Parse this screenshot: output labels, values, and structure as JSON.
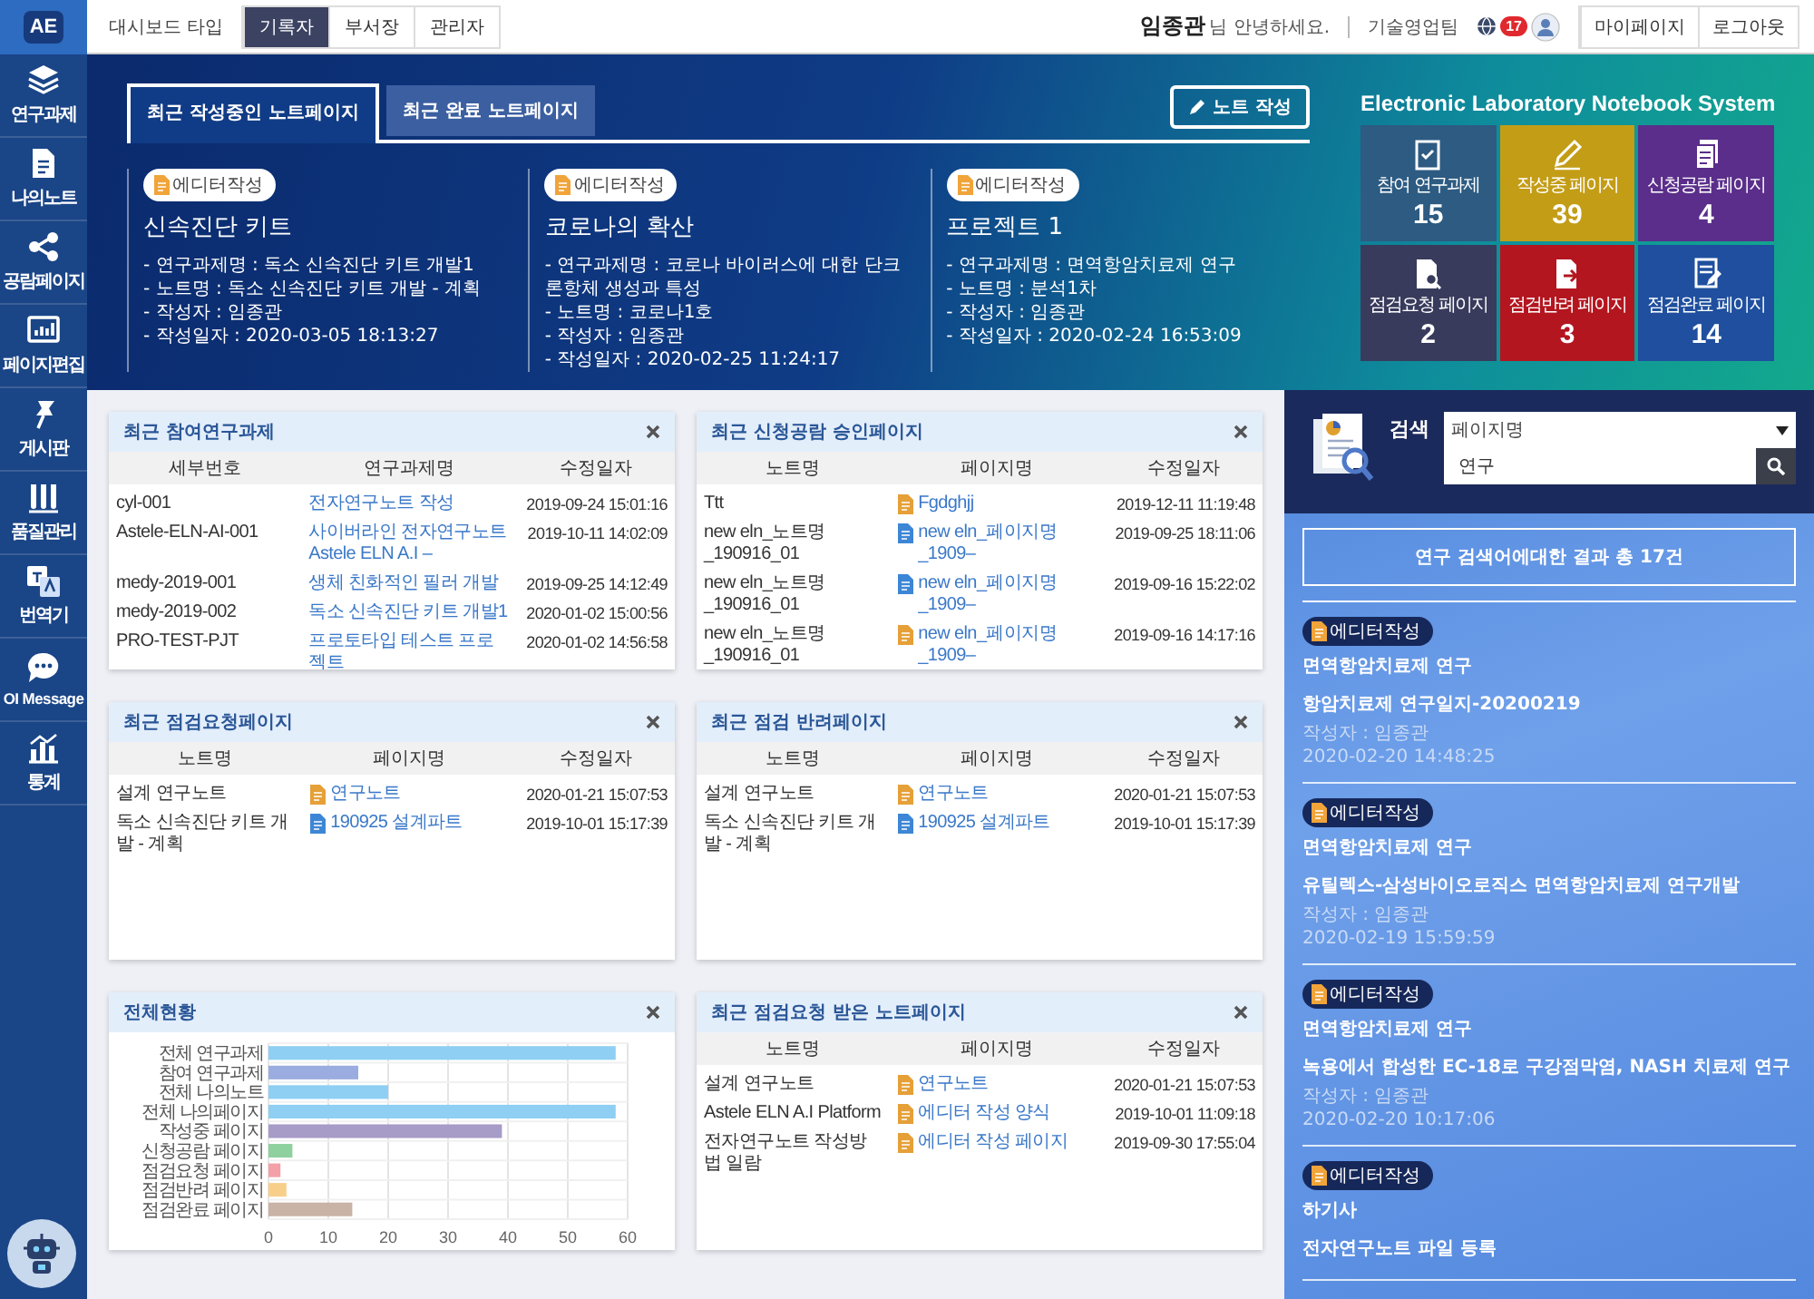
{
  "topbar": {
    "logo": "AE",
    "dashboard_label": "대시보드 타입",
    "dashboard_types": [
      {
        "label": "기록자",
        "selected": true
      },
      {
        "label": "부서장",
        "selected": false
      },
      {
        "label": "관리자",
        "selected": false
      }
    ],
    "user_name": "임종관",
    "greeting": "님 안녕하세요.",
    "team": "기술영업팀",
    "notification_count": "17",
    "buttons": [
      "마이페이지",
      "로그아웃"
    ]
  },
  "nav": [
    {
      "label": "연구과제"
    },
    {
      "label": "나의노트"
    },
    {
      "label": "공람페이지"
    },
    {
      "label": "페이지편집"
    },
    {
      "label": "게시판"
    },
    {
      "label": "품질관리"
    },
    {
      "label": "번역기"
    },
    {
      "label": "OI Message"
    },
    {
      "label": "통계"
    }
  ],
  "hero": {
    "tabs": [
      {
        "label": "최근 작성중인 노트페이지",
        "selected": true
      },
      {
        "label": "최근 완료 노트페이지",
        "selected": false
      }
    ],
    "write_button": "노트 작성",
    "cards": [
      {
        "badge": "에디터작성",
        "title": "신속진단 키트",
        "lines": [
          "- 연구과제명 : 독소 신속진단 키트 개발1",
          "- 노트명 : 독소 신속진단 키트 개발 - 계획",
          "- 작성자 : 임종관",
          "- 작성일자 : 2020-03-05 18:13:27"
        ]
      },
      {
        "badge": "에디터작성",
        "title": "코로나의 확산",
        "lines": [
          "- 연구과제명 : 코로나 바이러스에 대한 단크론항체 생성과 특성",
          "- 노트명 : 코로나1호",
          "- 작성자 : 임종관",
          "- 작성일자 : 2020-02-25 11:24:17"
        ]
      },
      {
        "badge": "에디터작성",
        "title": "프로젝트 1",
        "lines": [
          "- 연구과제명 : 면역항암치료제 연구",
          "- 노트명 : 분석1차",
          "- 작성자 : 임종관",
          "- 작성일자 : 2020-02-24 16:53:09"
        ]
      }
    ],
    "system_title": "Electronic Laboratory Notebook System",
    "tiles": [
      {
        "label": "참여 연구과제",
        "value": "15",
        "color": "#2d5b82"
      },
      {
        "label": "작성중 페이지",
        "value": "39",
        "color": "#c49d17"
      },
      {
        "label": "신청공람 페이지",
        "value": "4",
        "color": "#5a2e8a"
      },
      {
        "label": "점검요청 페이지",
        "value": "2",
        "color": "#383b5c"
      },
      {
        "label": "점검반려 페이지",
        "value": "3",
        "color": "#b3161f"
      },
      {
        "label": "점검완료 페이지",
        "value": "14",
        "color": "#1f4f9e"
      }
    ]
  },
  "panels": [
    {
      "kind": "table",
      "title": "최근 참여연구과제",
      "columns": [
        "세부번호",
        "연구과제명",
        "수정일자"
      ],
      "rows": [
        {
          "cells": [
            "cyl-001",
            {
              "text": "전자연구노트 작성"
            },
            "2019-09-24 15:01:16"
          ]
        },
        {
          "cells": [
            "Astele-ELN-AI-001",
            {
              "text": "사이버라인 전자연구노트 Astele ELN A.I –"
            },
            "2019-10-11 14:02:09"
          ]
        },
        {
          "cells": [
            "medy-2019-001",
            {
              "text": "생체 친화적인 필러 개발"
            },
            "2019-09-25 14:12:49"
          ]
        },
        {
          "cells": [
            "medy-2019-002",
            {
              "text": "독소 신속진단 키트 개발1"
            },
            "2020-01-02 15:00:56"
          ]
        },
        {
          "cells": [
            "PRO-TEST-PJT",
            {
              "text": "프로토타입 테스트 프로젝트"
            },
            "2020-01-02 14:56:58"
          ]
        }
      ]
    },
    {
      "kind": "table",
      "title": "최근 신청공람 승인페이지",
      "columns": [
        "노트명",
        "페이지명",
        "수정일자"
      ],
      "rows": [
        {
          "cells": [
            "Ttt",
            {
              "text": "Fgdghjj",
              "color": "#e5a038"
            },
            "2019-12-11 11:19:48"
          ]
        },
        {
          "cells": [
            "new eln_노트명_190916_01",
            {
              "text": "new eln_페이지명_1909–",
              "color": "#3d86d6"
            },
            "2019-09-25 18:11:06"
          ]
        },
        {
          "cells": [
            "new eln_노트명_190916_01",
            {
              "text": "new eln_페이지명_1909–",
              "color": "#3d86d6"
            },
            "2019-09-16 15:22:02"
          ]
        },
        {
          "cells": [
            "new eln_노트명_190916_01",
            {
              "text": "new eln_페이지명_1909–",
              "color": "#e5a038"
            },
            "2019-09-16 14:17:16"
          ]
        }
      ]
    },
    {
      "kind": "table",
      "title": "최근 점검요청페이지",
      "columns": [
        "노트명",
        "페이지명",
        "수정일자"
      ],
      "rows": [
        {
          "cells": [
            "설계 연구노트",
            {
              "text": "연구노트",
              "color": "#e5a038"
            },
            "2020-01-21 15:07:53"
          ]
        },
        {
          "cells": [
            "독소 신속진단 키트 개발 - 계획",
            {
              "text": "190925 설계파트",
              "color": "#3d86d6"
            },
            "2019-10-01 15:17:39"
          ]
        }
      ]
    },
    {
      "kind": "table",
      "title": "최근 점검 반려페이지",
      "columns": [
        "노트명",
        "페이지명",
        "수정일자"
      ],
      "rows": [
        {
          "cells": [
            "설계 연구노트",
            {
              "text": "연구노트",
              "color": "#e5a038"
            },
            "2020-01-21 15:07:53"
          ]
        },
        {
          "cells": [
            "독소 신속진단 키트 개발 - 계획",
            {
              "text": "190925 설계파트",
              "color": "#3d86d6"
            },
            "2019-10-01 15:17:39"
          ]
        }
      ]
    },
    {
      "kind": "chart",
      "title": "전체현황",
      "chart_data": {
        "type": "bar",
        "orientation": "horizontal",
        "categories": [
          "전체 연구과제",
          "참여 연구과제",
          "전체 나의노트",
          "전체 나의페이지",
          "작성중 페이지",
          "신청공람 페이지",
          "점검요청 페이지",
          "점검반려 페이지",
          "점검완료 페이지"
        ],
        "values": [
          58,
          15,
          20,
          58,
          39,
          4,
          2,
          3,
          14
        ],
        "colors": [
          "#8ecff3",
          "#9badE0",
          "#8ecff3",
          "#8ecff3",
          "#a79bc8",
          "#8fd19e",
          "#f4a0a8",
          "#f8cf8a",
          "#c9b2a6"
        ],
        "xlim": [
          0,
          60
        ],
        "xticks": [
          0,
          10,
          20,
          30,
          40,
          50,
          60
        ],
        "grid": true
      }
    },
    {
      "kind": "table",
      "title": "최근 점검요청 받은 노트페이지",
      "columns": [
        "노트명",
        "페이지명",
        "수정일자"
      ],
      "rows": [
        {
          "cells": [
            "설계 연구노트",
            {
              "text": "연구노트",
              "color": "#e5a038"
            },
            "2020-01-21 15:07:53"
          ]
        },
        {
          "cells": [
            "Astele ELN A.I Platform",
            {
              "text": "에디터 작성 양식",
              "color": "#e5a038"
            },
            "2019-10-01 11:09:18"
          ]
        },
        {
          "cells": [
            "전자연구노트 작성방법 일람",
            {
              "text": "에디터 작성 페이지",
              "color": "#e5a038"
            },
            "2019-09-30 17:55:04"
          ]
        }
      ]
    }
  ],
  "search": {
    "label": "검색",
    "field": "페이지명",
    "value": "연구",
    "summary": "연구 검색어에대한 결과 총 17건",
    "results": [
      {
        "badge": "에디터작성",
        "project": "면역항암치료제 연구",
        "title": "항암치료제 연구일지-20200219",
        "author": "작성자 : 임종관",
        "date": "2020-02-20 14:48:25"
      },
      {
        "badge": "에디터작성",
        "project": "면역항암치료제 연구",
        "title": "유틸렉스-삼성바이오로직스 면역항암치료제 연구개발",
        "author": "작성자 : 임종관",
        "date": "2020-02-19 15:59:59"
      },
      {
        "badge": "에디터작성",
        "project": "면역항암치료제 연구",
        "title": "녹용에서 합성한 EC-18로 구강점막염, NASH 치료제 연구",
        "author": "작성자 : 임종관",
        "date": "2020-02-20 10:17:06"
      },
      {
        "badge": "에디터작성",
        "project": "하기사",
        "title": "전자연구노트 파일 등록"
      }
    ]
  }
}
